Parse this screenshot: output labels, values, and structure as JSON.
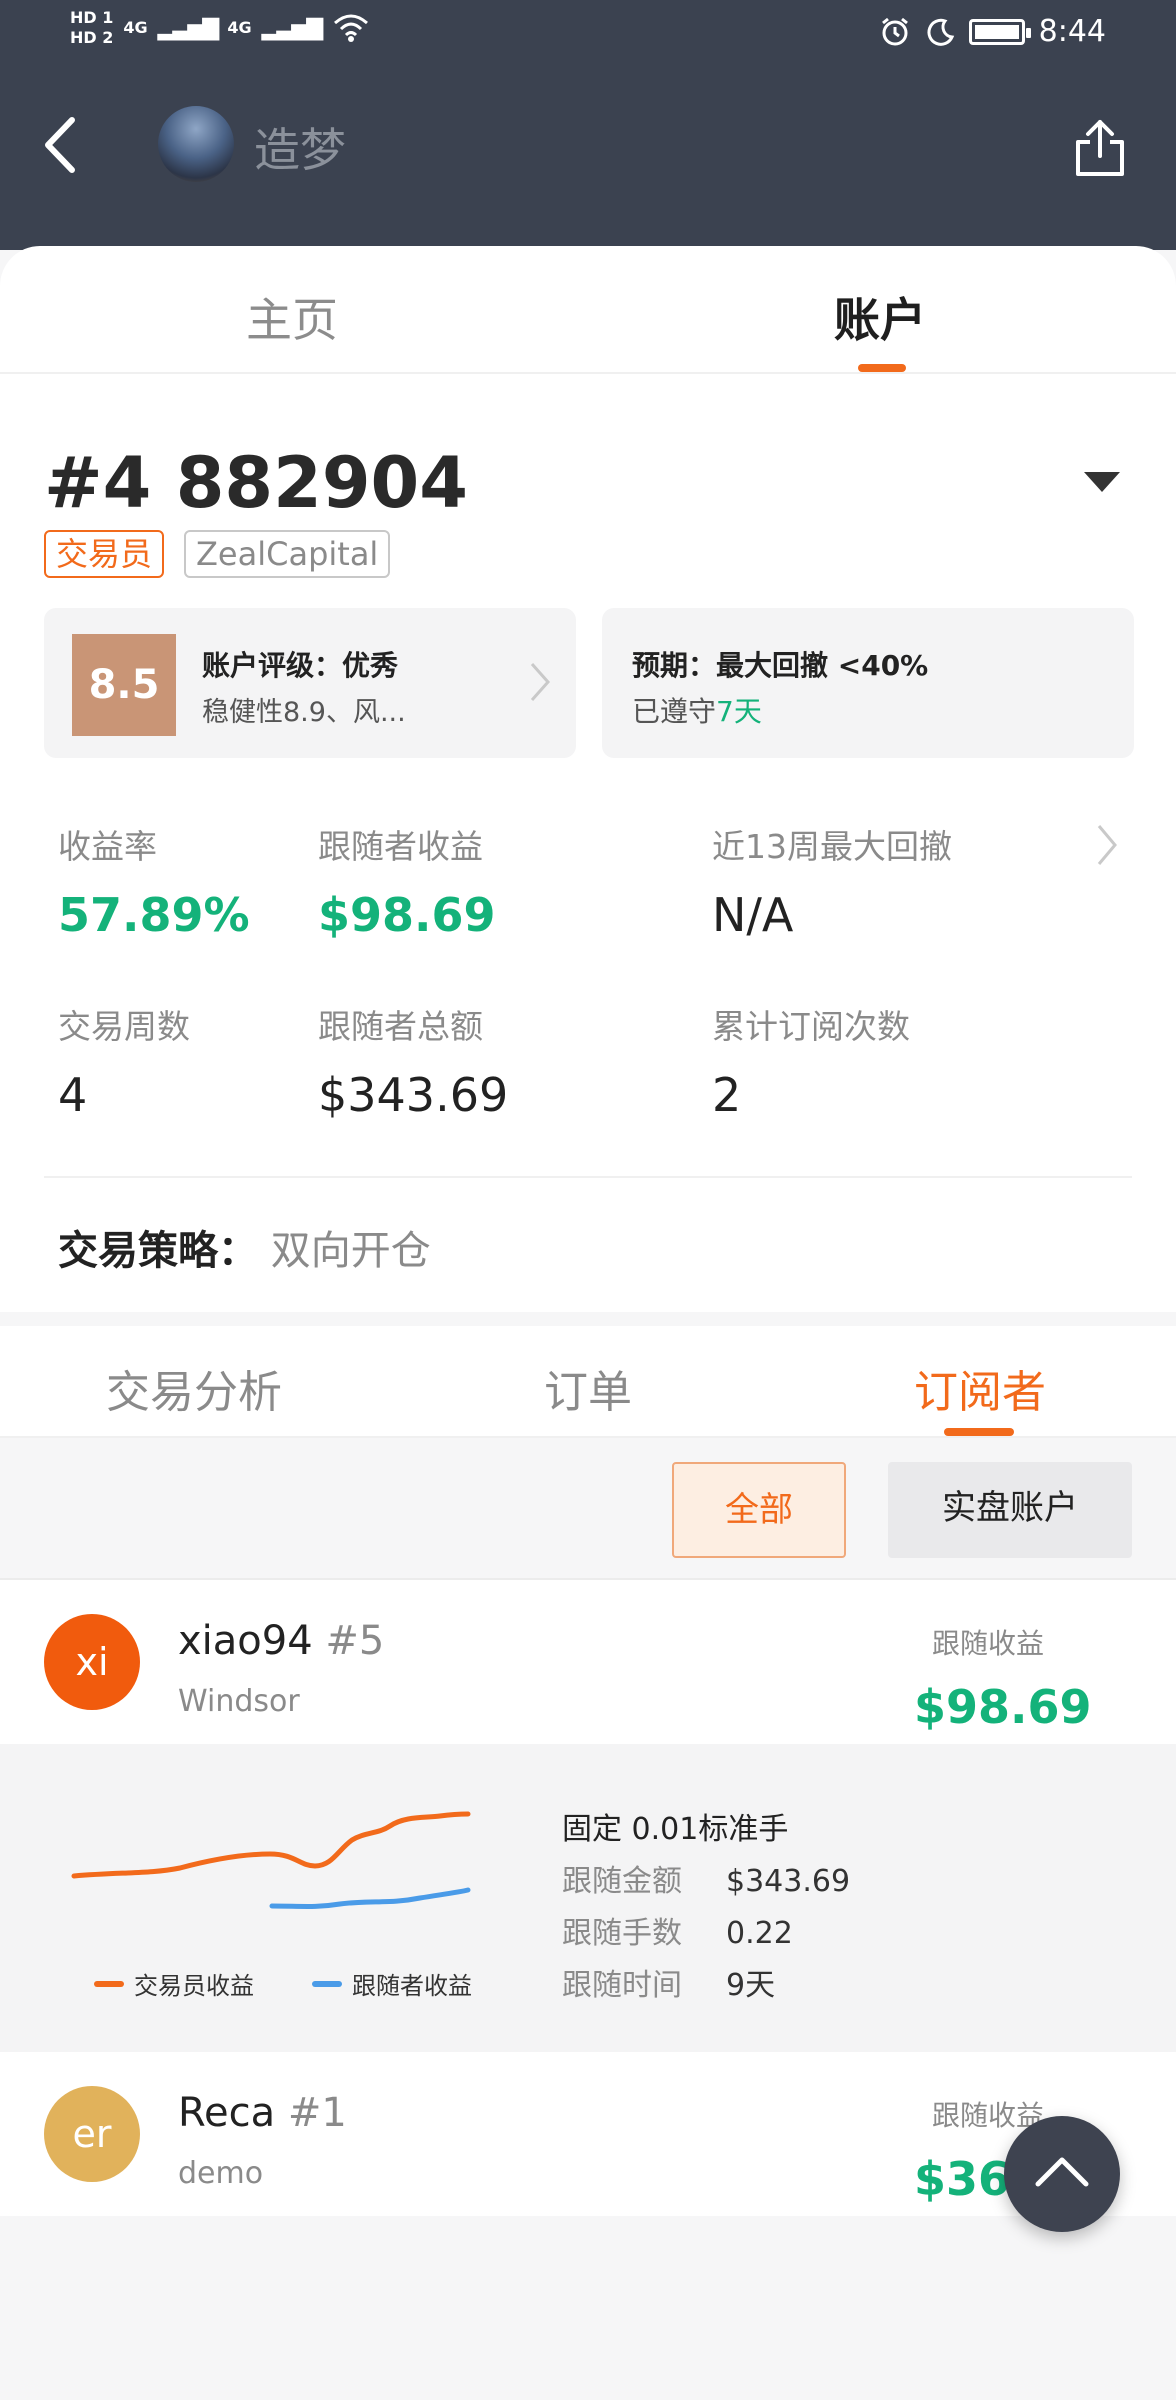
{
  "status_bar": {
    "hd1": "HD 1",
    "hd2": "HD 2",
    "net1": "4G",
    "net2": "4G",
    "time": "8:44"
  },
  "header": {
    "title": "造梦"
  },
  "top_tabs": {
    "home": "主页",
    "account": "账户"
  },
  "account": {
    "number": "#4 882904",
    "tag_role": "交易员",
    "tag_company": "ZealCapital",
    "rating": {
      "score": "8.5",
      "title": "账户评级：优秀",
      "subtitle": "稳健性8.9、风..."
    },
    "expectation": {
      "title": "预期：最大回撤 <40%",
      "kept_prefix": "已遵守",
      "kept_days": "7天"
    },
    "stats": {
      "return_label": "收益率",
      "return_value": "57.89%",
      "follower_profit_label": "跟随者收益",
      "follower_profit_value": "$98.69",
      "drawdown_label": "近13周最大回撤",
      "drawdown_value": "N/A",
      "weeks_label": "交易周数",
      "weeks_value": "4",
      "follower_total_label": "跟随者总额",
      "follower_total_value": "$343.69",
      "subs_label": "累计订阅次数",
      "subs_value": "2"
    },
    "strategy_key": "交易策略：",
    "strategy_value": "双向开仓"
  },
  "sub_tabs": {
    "analysis": "交易分析",
    "orders": "订单",
    "subscribers": "订阅者"
  },
  "filters": {
    "all": "全部",
    "real": "实盘账户"
  },
  "subscribers": [
    {
      "initials": "xi",
      "name": "xiao94",
      "rank": "#5",
      "account": "Windsor",
      "earn_label": "跟随收益",
      "earn_value": "$98.69"
    },
    {
      "initials": "er",
      "name": "Reca",
      "rank": "#1",
      "account": "demo",
      "earn_label": "跟随收益",
      "earn_value": "$36.58"
    }
  ],
  "detail": {
    "title": "固定 0.01标准手",
    "amount_label": "跟随金额",
    "amount_value": "$343.69",
    "lots_label": "跟随手数",
    "lots_value": "0.22",
    "time_label": "跟随时间",
    "time_value": "9天",
    "legend_trader": "交易员收益",
    "legend_follower": "跟随者收益",
    "colors": {
      "trader": "#f26a1b",
      "follower": "#4a9be8"
    }
  },
  "icons": {
    "back": "chevron-left-icon",
    "share": "share-icon",
    "fab": "chevron-up-icon"
  }
}
